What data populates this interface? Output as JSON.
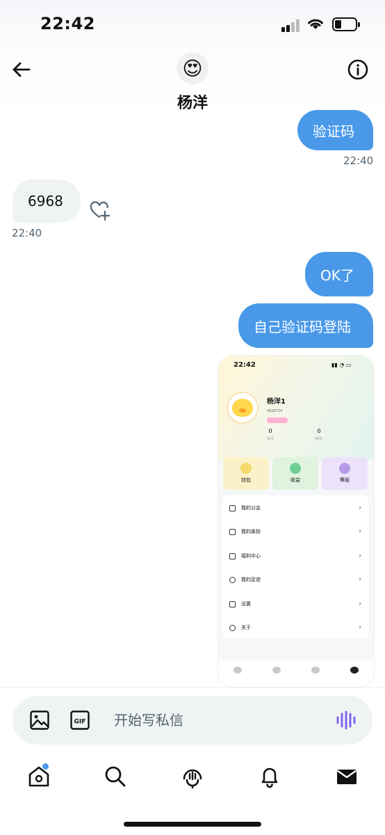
{
  "status": {
    "time": "22:42"
  },
  "header": {
    "name": "杨洋",
    "avatar_emoji": "😍"
  },
  "messages": [
    {
      "dir": "out",
      "text": "验证码",
      "time": "22:40"
    },
    {
      "dir": "in",
      "text": "6968",
      "time": "22:40"
    },
    {
      "dir": "out",
      "text": "OK了"
    },
    {
      "dir": "out",
      "text": "自己验证码登陆"
    }
  ],
  "shot": {
    "time": "22:42",
    "name": "杨洋1",
    "id": "4926734",
    "stats": [
      {
        "n": "0",
        "l": "关注"
      },
      {
        "n": "0",
        "l": "粉丝"
      }
    ],
    "cards": [
      {
        "label": "钱包",
        "bg": "#fbf1c9",
        "dot": "#f5d96a"
      },
      {
        "label": "收益",
        "bg": "#dff3df",
        "dot": "#6fcf97"
      },
      {
        "label": "等级",
        "bg": "#ece3fb",
        "dot": "#b69be8"
      }
    ],
    "menu": [
      "我的公会",
      "我的装扮",
      "福利中心",
      "我的足迹",
      "设置",
      "关于"
    ]
  },
  "composer": {
    "placeholder": "开始写私信"
  },
  "colors": {
    "accent": "#4a99e9",
    "voice": "#7b5cf0"
  }
}
